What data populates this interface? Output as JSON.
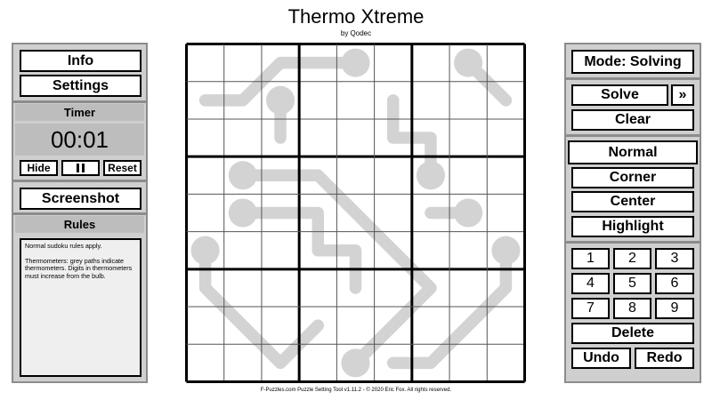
{
  "header": {
    "title": "Thermo Xtreme",
    "subtitle": "by Qodec"
  },
  "footer": {
    "text": "F-Puzzles.com Puzzle Setting Tool v1.11.2 - © 2020 Eric Fox. All rights reserved."
  },
  "left_panel": {
    "info_label": "Info",
    "settings_label": "Settings",
    "timer_label": "Timer",
    "timer_value": "00:01",
    "hide_label": "Hide",
    "reset_label": "Reset",
    "screenshot_label": "Screenshot",
    "rules_label": "Rules",
    "rules_paragraphs": [
      "Normal sudoku rules apply.",
      "Thermometers: grey paths indicate thermometers. Digits in thermometers must increase from the bulb."
    ]
  },
  "right_panel": {
    "mode_label": "Mode: Solving",
    "solve_label": "Solve",
    "more_label": "»",
    "clear_label": "Clear",
    "modes": [
      "Normal",
      "Corner",
      "Center",
      "Highlight"
    ],
    "digits": [
      "1",
      "2",
      "3",
      "4",
      "5",
      "6",
      "7",
      "8",
      "9"
    ],
    "delete_label": "Delete",
    "undo_label": "Undo",
    "redo_label": "Redo"
  },
  "colors": {
    "panel_bg": "#cfcfcf",
    "panel_border": "#8c8c8c",
    "thermo": "#d3d3d3",
    "grid_line": "#000000"
  },
  "puzzle": {
    "size": 9,
    "given_digits": [],
    "thermometers": [
      {
        "bulb": [
          4,
          0
        ],
        "path": [
          [
            4,
            0
          ],
          [
            3,
            0
          ],
          [
            2,
            0
          ],
          [
            1,
            1
          ],
          [
            0,
            1
          ]
        ]
      },
      {
        "bulb": [
          2,
          1
        ],
        "path": [
          [
            2,
            1
          ],
          [
            2,
            2
          ]
        ]
      },
      {
        "bulb": [
          0,
          5
        ],
        "path": [
          [
            0,
            5
          ],
          [
            0,
            6
          ],
          [
            1,
            7
          ],
          [
            2,
            8
          ],
          [
            3,
            7
          ]
        ]
      },
      {
        "bulb": [
          1,
          3
        ],
        "path": [
          [
            1,
            3
          ],
          [
            3,
            3
          ],
          [
            4,
            4
          ],
          [
            5,
            5
          ],
          [
            6,
            6
          ]
        ]
      },
      {
        "bulb": [
          1,
          4
        ],
        "path": [
          [
            1,
            4
          ],
          [
            3,
            4
          ],
          [
            3,
            5
          ],
          [
            4,
            5
          ],
          [
            4,
            6
          ]
        ]
      },
      {
        "bulb": [
          4,
          8
        ],
        "path": [
          [
            4,
            8
          ],
          [
            5,
            7
          ],
          [
            6,
            6
          ]
        ]
      },
      {
        "bulb": [
          6,
          3
        ],
        "path": [
          [
            6,
            3
          ],
          [
            6,
            2
          ],
          [
            5,
            2
          ],
          [
            5,
            1
          ]
        ]
      },
      {
        "bulb": [
          7,
          4
        ],
        "path": [
          [
            7,
            4
          ],
          [
            6,
            4
          ]
        ]
      },
      {
        "bulb": [
          8,
          5
        ],
        "path": [
          [
            8,
            5
          ],
          [
            8,
            6
          ],
          [
            7,
            7
          ],
          [
            6,
            8
          ],
          [
            5,
            8
          ]
        ]
      },
      {
        "bulb": [
          7,
          0
        ],
        "path": [
          [
            7,
            0
          ],
          [
            8,
            1
          ]
        ]
      }
    ]
  }
}
